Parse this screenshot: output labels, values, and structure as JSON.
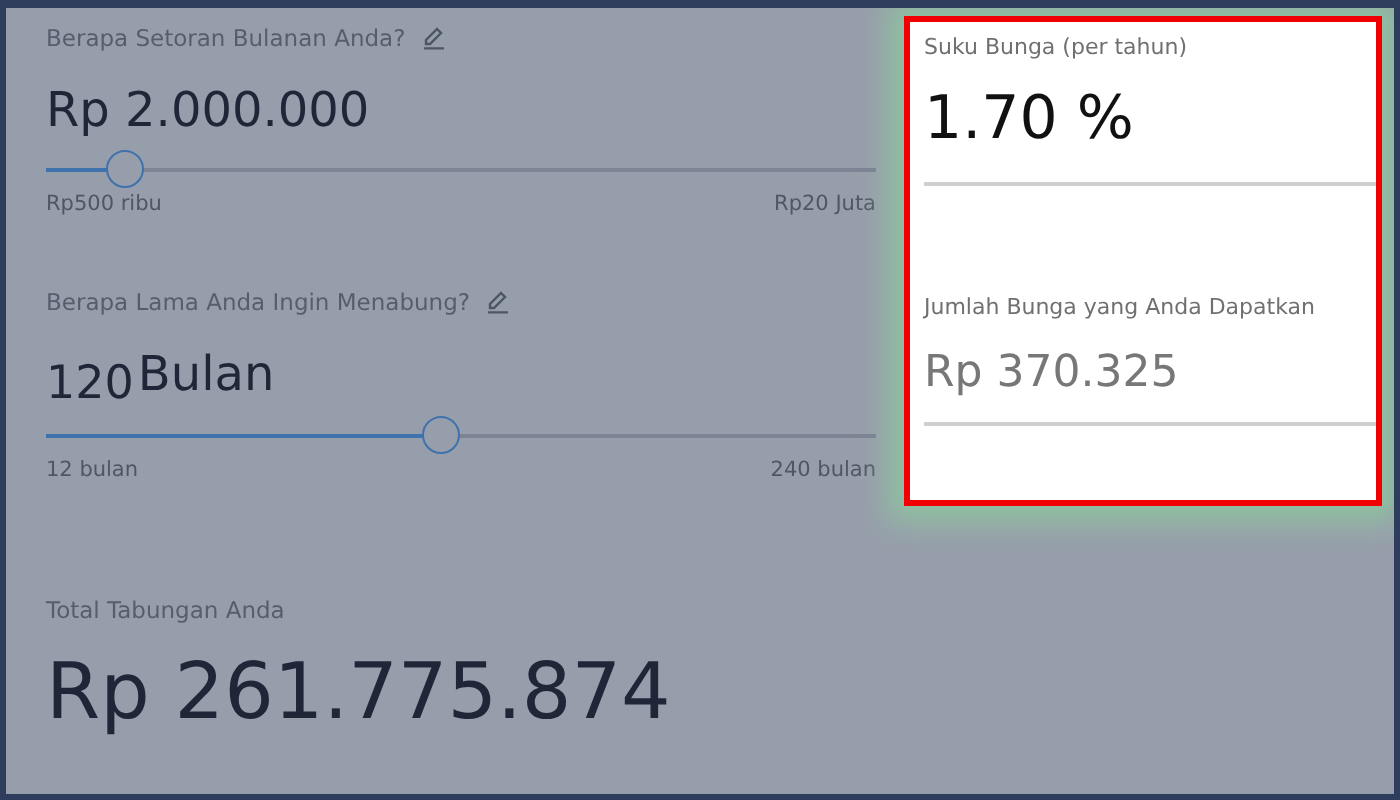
{
  "monthly_deposit": {
    "label": "Berapa Setoran Bulanan Anda?",
    "value": "Rp 2.000.000",
    "level": 0.094,
    "min_label": "Rp500 ribu",
    "max_label": "Rp20 Juta"
  },
  "duration": {
    "label": "Berapa Lama Anda Ingin Menabung?",
    "value": "120",
    "unit": "Bulan",
    "level": 0.475,
    "min_label": "12 bulan",
    "max_label": "240 bulan"
  },
  "highlight": {
    "interest_rate": {
      "label": "Suku Bunga (per tahun)",
      "value": "1.70 %"
    },
    "interest_earned": {
      "label": "Jumlah Bunga yang Anda Dapatkan",
      "value": "Rp 370.325"
    }
  },
  "total": {
    "label": "Total Tabungan Anda",
    "value": "Rp 261.775.874"
  }
}
